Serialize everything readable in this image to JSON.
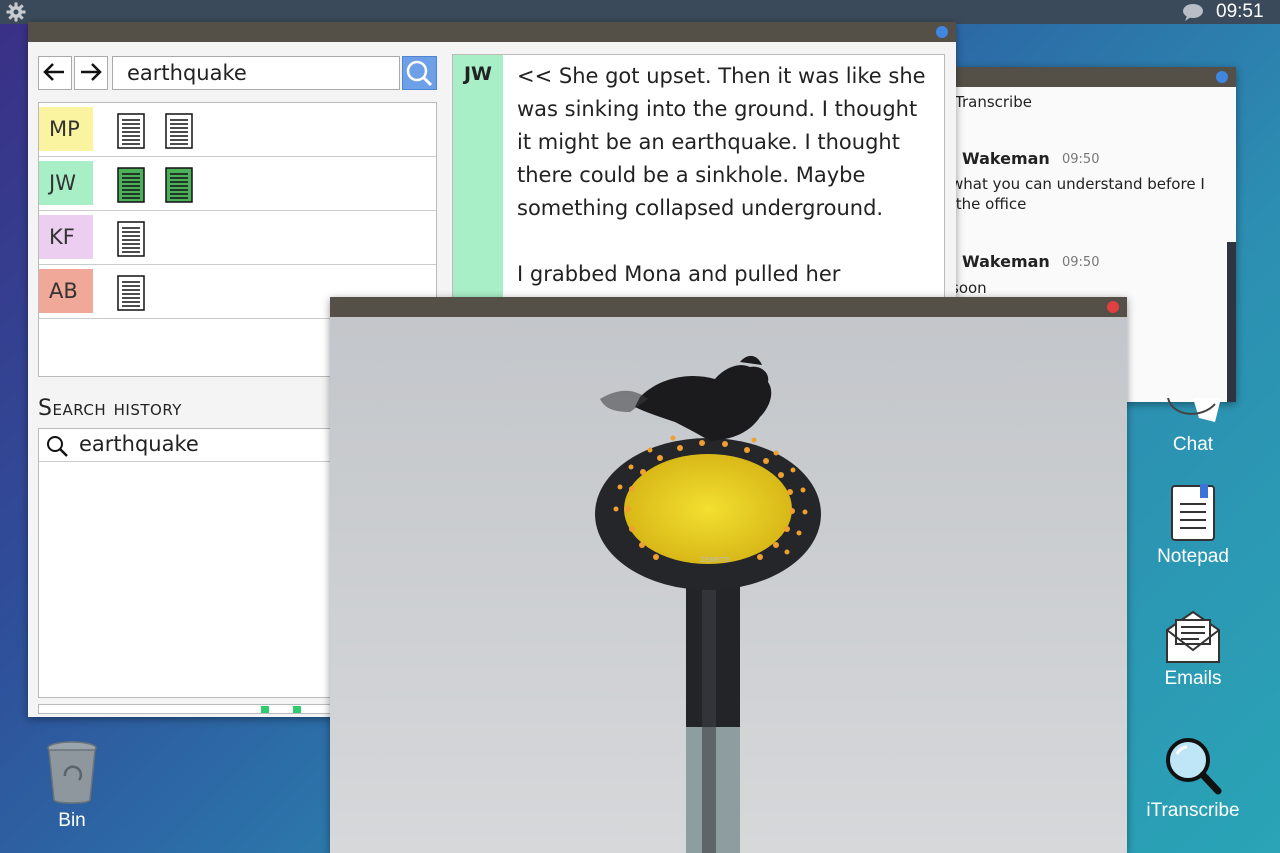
{
  "topbar": {
    "clock": "09:51",
    "settings_icon": "gear-icon",
    "chat_icon": "chat-bubble-icon"
  },
  "search_window": {
    "query": "earthquake",
    "results": [
      {
        "initials": "MP",
        "color": "#faf3a0",
        "docs": [
          "plain",
          "plain"
        ]
      },
      {
        "initials": "JW",
        "color": "#a8eec6",
        "docs": [
          "green",
          "green"
        ]
      },
      {
        "initials": "KF",
        "color": "#eccff0",
        "docs": [
          "plain"
        ]
      },
      {
        "initials": "AB",
        "color": "#f0a898",
        "docs": [
          "plain"
        ]
      }
    ],
    "history_title": "Search history",
    "history": [
      "earthquake"
    ],
    "transcript": {
      "speaker": "JW",
      "paragraphs": [
        "<<  She got upset. Then it was like she was sinking into the ground. I thought it might be an earthquake. I thought there could be a sinkhole. Maybe something collapsed underground.",
        "I grabbed Mona and pulled her towards"
      ]
    }
  },
  "chat_window": {
    "title": "Transcribe",
    "messages": [
      {
        "name": "Wakeman",
        "time": "09:50",
        "text": "what you can understand before I  the office"
      },
      {
        "name": "Wakeman",
        "time": "09:50",
        "text": "soon"
      }
    ]
  },
  "viewer": {
    "image": "bird-on-street-lamp",
    "brand_text": "ZEBRITE"
  },
  "desktop": {
    "icons": [
      {
        "label": "Bin",
        "icon": "bin-icon"
      },
      {
        "label": "Chat",
        "icon": "chat-icon"
      },
      {
        "label": "Notepad",
        "icon": "notepad-icon"
      },
      {
        "label": "Emails",
        "icon": "email-icon"
      },
      {
        "label": "iTranscribe",
        "icon": "magnifier-icon"
      }
    ]
  }
}
